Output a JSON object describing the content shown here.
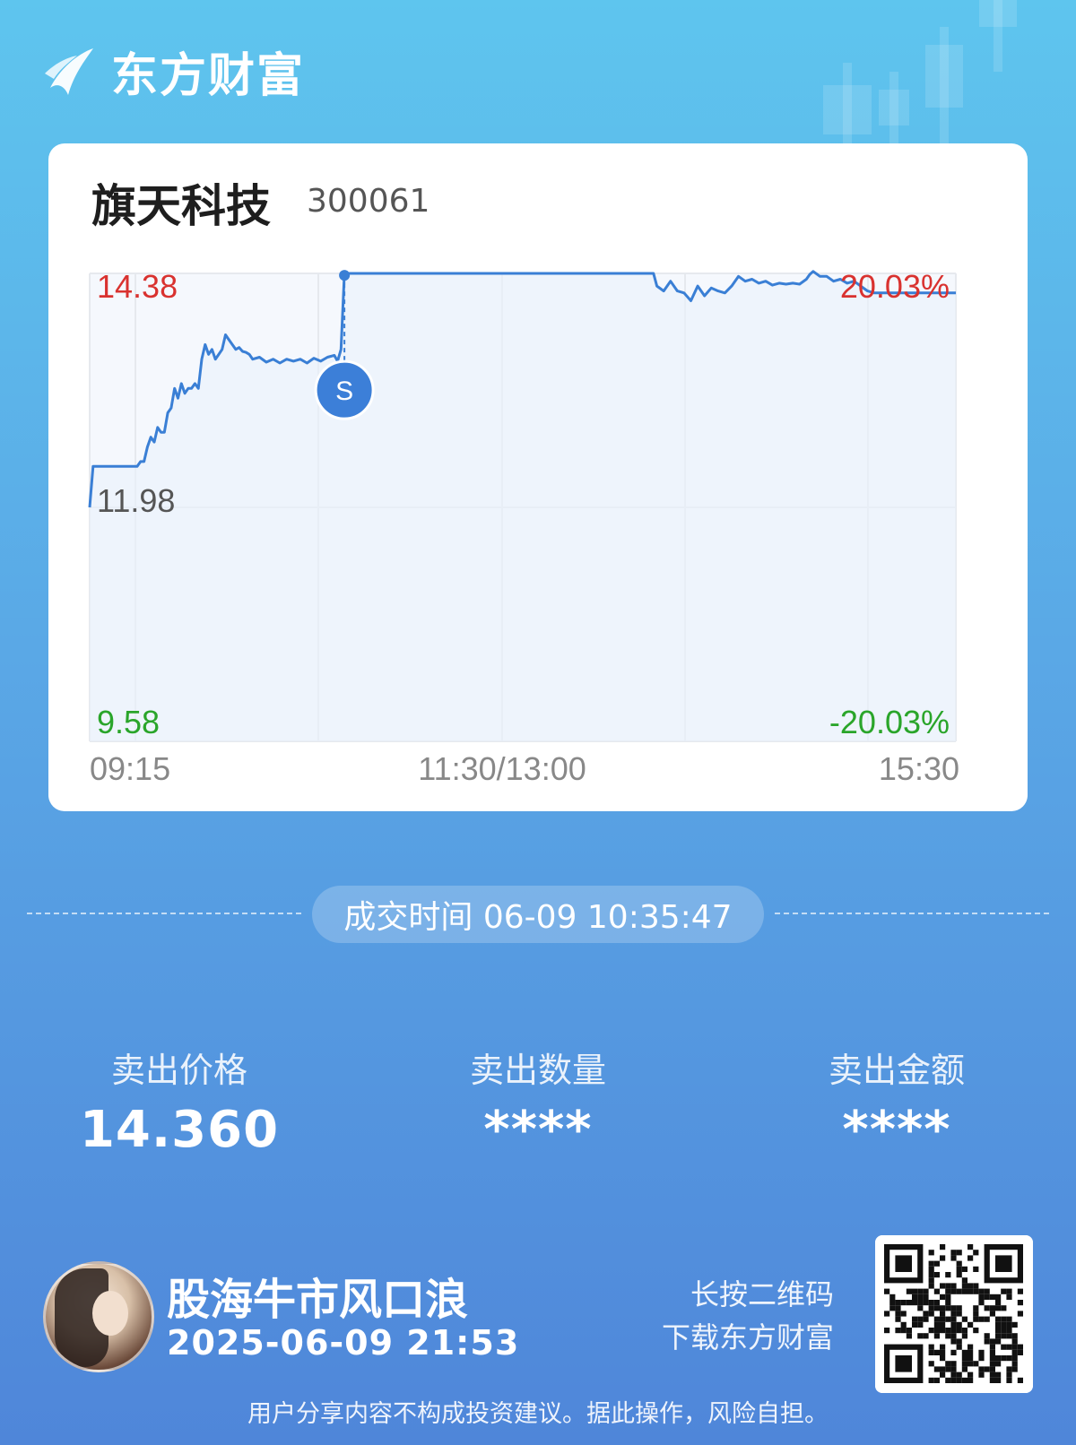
{
  "brand": {
    "name": "东方财富",
    "logo_icon": "eastmoney-logo-icon"
  },
  "stock": {
    "name": "旗天科技",
    "code": "300061"
  },
  "chart_data": {
    "type": "line",
    "title": "",
    "price_high": "14.38",
    "price_base": "11.98",
    "price_low": "9.58",
    "pct_high": "20.03%",
    "pct_low": "-20.03%",
    "ylim": [
      9.58,
      14.38
    ],
    "x_ticks": [
      "09:15",
      "11:30/13:00",
      "15:30"
    ],
    "colors": {
      "up": "#d9322f",
      "down": "#2aa52a",
      "line": "#3a7fd5"
    },
    "series": [
      {
        "values": [
          [
            0,
            11.98
          ],
          [
            1,
            12.4
          ],
          [
            2,
            12.4
          ],
          [
            4,
            12.4
          ],
          [
            6,
            12.4
          ],
          [
            8,
            12.4
          ],
          [
            10,
            12.4
          ],
          [
            12,
            12.4
          ],
          [
            14,
            12.4
          ],
          [
            15,
            12.45
          ],
          [
            16,
            12.45
          ],
          [
            17,
            12.6
          ],
          [
            18,
            12.7
          ],
          [
            19,
            12.65
          ],
          [
            20,
            12.8
          ],
          [
            21,
            12.75
          ],
          [
            22,
            12.75
          ],
          [
            23,
            12.95
          ],
          [
            24,
            13.0
          ],
          [
            25,
            13.2
          ],
          [
            26,
            13.1
          ],
          [
            27,
            13.25
          ],
          [
            28,
            13.15
          ],
          [
            29,
            13.2
          ],
          [
            30,
            13.2
          ],
          [
            31,
            13.25
          ],
          [
            32,
            13.2
          ],
          [
            33,
            13.5
          ],
          [
            34,
            13.65
          ],
          [
            35,
            13.55
          ],
          [
            36,
            13.6
          ],
          [
            37,
            13.5
          ],
          [
            38,
            13.55
          ],
          [
            39,
            13.6
          ],
          [
            40,
            13.75
          ],
          [
            41,
            13.7
          ],
          [
            42,
            13.65
          ],
          [
            43,
            13.6
          ],
          [
            44,
            13.62
          ],
          [
            45,
            13.58
          ],
          [
            46,
            13.57
          ],
          [
            47,
            13.55
          ],
          [
            48,
            13.5
          ],
          [
            50,
            13.52
          ],
          [
            52,
            13.47
          ],
          [
            54,
            13.5
          ],
          [
            56,
            13.46
          ],
          [
            58,
            13.5
          ],
          [
            60,
            13.48
          ],
          [
            62,
            13.5
          ],
          [
            64,
            13.46
          ],
          [
            66,
            13.51
          ],
          [
            68,
            13.48
          ],
          [
            70,
            13.52
          ],
          [
            72,
            13.54
          ],
          [
            73,
            13.48
          ],
          [
            74,
            13.6
          ],
          [
            75,
            14.38
          ],
          [
            80,
            14.38
          ],
          [
            100,
            14.38
          ],
          [
            120,
            14.38
          ],
          [
            140,
            14.38
          ],
          [
            150,
            14.38
          ],
          [
            166,
            14.38
          ],
          [
            167,
            14.25
          ],
          [
            169,
            14.2
          ],
          [
            171,
            14.3
          ],
          [
            173,
            14.2
          ],
          [
            175,
            14.18
          ],
          [
            177,
            14.1
          ],
          [
            179,
            14.25
          ],
          [
            181,
            14.15
          ],
          [
            183,
            14.23
          ],
          [
            185,
            14.2
          ],
          [
            187,
            14.18
          ],
          [
            189,
            14.25
          ],
          [
            191,
            14.35
          ],
          [
            193,
            14.3
          ],
          [
            195,
            14.32
          ],
          [
            197,
            14.28
          ],
          [
            199,
            14.3
          ],
          [
            201,
            14.26
          ],
          [
            203,
            14.28
          ],
          [
            205,
            14.27
          ],
          [
            207,
            14.28
          ],
          [
            209,
            14.27
          ],
          [
            211,
            14.32
          ],
          [
            212,
            14.37
          ],
          [
            213,
            14.4
          ],
          [
            215,
            14.35
          ],
          [
            217,
            14.35
          ],
          [
            219,
            14.3
          ],
          [
            221,
            14.32
          ],
          [
            223,
            14.28
          ],
          [
            225,
            14.3
          ],
          [
            227,
            14.25
          ],
          [
            229,
            14.2
          ],
          [
            231,
            14.18
          ],
          [
            233,
            14.18
          ],
          [
            240,
            14.18
          ],
          [
            255,
            14.18
          ]
        ]
      }
    ],
    "sell_marker": {
      "label": "S",
      "price": 14.36
    }
  },
  "trade": {
    "time_label": "成交时间 06-09 10:35:47"
  },
  "stats": [
    {
      "label": "卖出价格",
      "value": "14.360"
    },
    {
      "label": "卖出数量",
      "value": "****"
    },
    {
      "label": "卖出金额",
      "value": "****"
    }
  ],
  "user": {
    "name": "股海牛市风口浪",
    "date": "2025-06-09 21:53",
    "avatar_icon": "user-avatar"
  },
  "qr": {
    "hint_line1": "长按二维码",
    "hint_line2": "下载东方财富",
    "icon": "qr-code-icon"
  },
  "disclaimer": "用户分享内容不构成投资建议。据此操作，风险自担。"
}
